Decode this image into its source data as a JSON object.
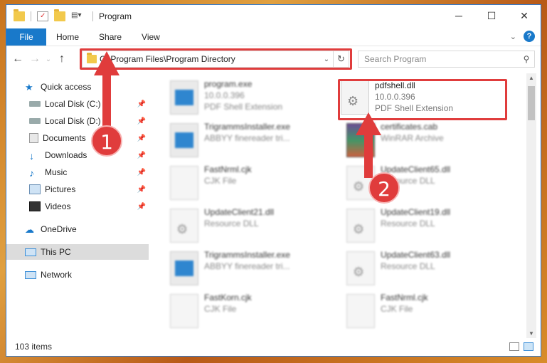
{
  "window": {
    "title": "Program",
    "minimize_glyph": "─",
    "maximize_glyph": "☐",
    "close_glyph": "✕"
  },
  "ribbon": {
    "tabs": [
      "File",
      "Home",
      "Share",
      "View"
    ],
    "help_glyph": "?"
  },
  "address_bar": {
    "path": "C:\\Program Files\\Program Directory",
    "refresh_glyph": "↻",
    "dropdown_glyph": "⌄"
  },
  "search": {
    "placeholder": "Search Program",
    "icon": "search-icon"
  },
  "sidebar": {
    "items": [
      {
        "label": "Quick access",
        "icon": "star-icon"
      },
      {
        "label": "Local Disk (C:)",
        "icon": "drive-icon",
        "pinned": true
      },
      {
        "label": "Local Disk (D:)",
        "icon": "drive-icon",
        "pinned": true
      },
      {
        "label": "Documents",
        "icon": "documents-icon",
        "pinned": true
      },
      {
        "label": "Downloads",
        "icon": "download-icon",
        "pinned": true
      },
      {
        "label": "Music",
        "icon": "music-icon",
        "pinned": true
      },
      {
        "label": "Pictures",
        "icon": "pictures-icon",
        "pinned": true
      },
      {
        "label": "Videos",
        "icon": "videos-icon",
        "pinned": true
      },
      {
        "label": "OneDrive",
        "icon": "cloud-icon"
      },
      {
        "label": "This PC",
        "icon": "computer-icon",
        "selected": true
      },
      {
        "label": "Network",
        "icon": "network-icon"
      }
    ]
  },
  "files": [
    {
      "name": "program.exe",
      "line2": "10.0.0.396",
      "line3": "PDF Shell Extension",
      "kind": "exe"
    },
    {
      "name": "pdfshell.dll",
      "line2": "10.0.0.396",
      "line3": "PDF Shell Extension",
      "kind": "dll",
      "highlighted": true
    },
    {
      "name": "TrigrammsInstaller.exe",
      "line2": "ABBYY finereader tri...",
      "kind": "exe"
    },
    {
      "name": "certificates.cab",
      "line2": "WinRAR Archive",
      "kind": "cab"
    },
    {
      "name": "FastNrml.cjk",
      "line2": "CJK File",
      "kind": "doc"
    },
    {
      "name": "UpdateClient65.dll",
      "line2": "Resource DLL",
      "kind": "dll"
    },
    {
      "name": "UpdateClient21.dll",
      "line2": "Resource DLL",
      "kind": "dll"
    },
    {
      "name": "UpdateClient19.dll",
      "line2": "Resource DLL",
      "kind": "dll"
    },
    {
      "name": "TrigrammsInstaller.exe",
      "line2": "ABBYY finereader tri...",
      "kind": "exe"
    },
    {
      "name": "UpdateClient63.dll",
      "line2": "Resource DLL",
      "kind": "dll"
    },
    {
      "name": "FastKorn.cjk",
      "line2": "CJK File",
      "kind": "doc"
    },
    {
      "name": "FastNrml.cjk",
      "line2": "CJK File",
      "kind": "doc"
    }
  ],
  "status": {
    "item_count": "103 items"
  },
  "callouts": {
    "step1": "1",
    "step2": "2"
  },
  "colors": {
    "accent": "#1979ca",
    "callout_red": "#e03c3c"
  }
}
